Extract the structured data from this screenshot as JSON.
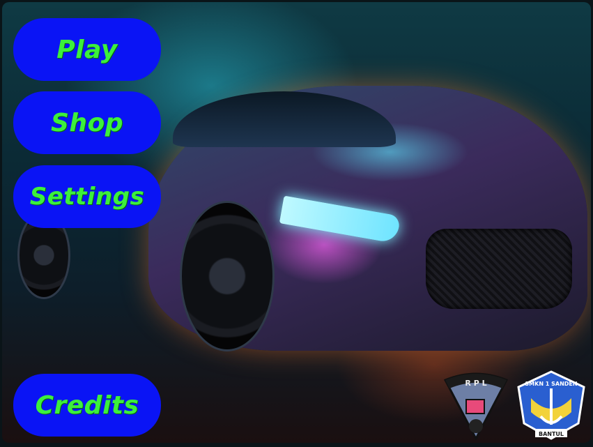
{
  "menu": {
    "play_label": "Play",
    "shop_label": "Shop",
    "settings_label": "Settings",
    "credits_label": "Credits"
  },
  "logos": {
    "rpl_text": "R P L",
    "school_top": "SMKN 1 SANDEN",
    "school_bottom": "BANTUL"
  },
  "colors": {
    "button_bg": "#0a14f5",
    "button_text": "#3cf03c"
  }
}
